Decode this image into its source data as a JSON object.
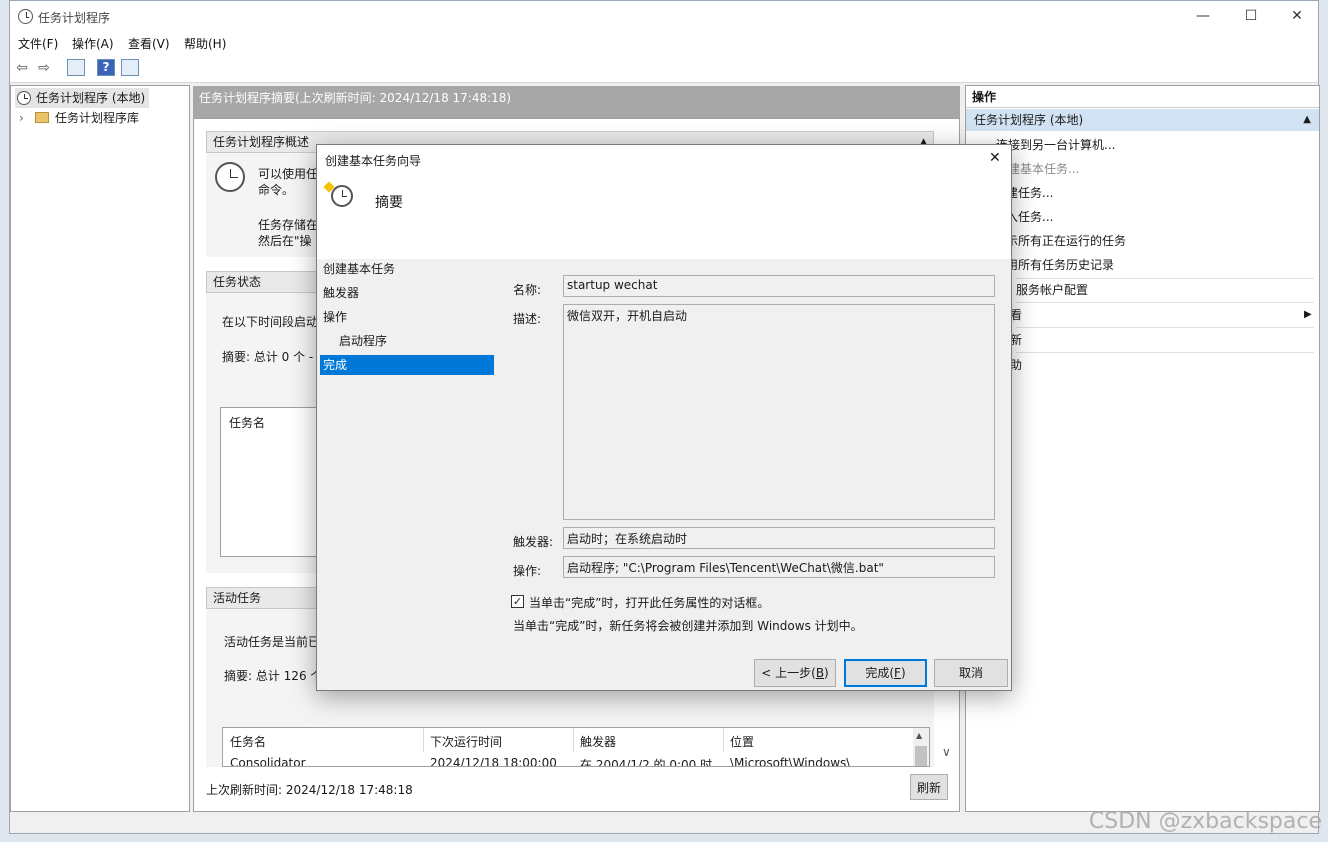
{
  "window": {
    "title": "任务计划程序",
    "minimize": "—",
    "maximize": "☐",
    "close": "✕"
  },
  "menu": [
    "文件(F)",
    "操作(A)",
    "查看(V)",
    "帮助(H)"
  ],
  "toolbar": {
    "back": "⇦",
    "forward": "⇨",
    "help": "?"
  },
  "tree": {
    "root": "任务计划程序 (本地)",
    "library": "任务计划程序库",
    "expander": "›"
  },
  "middle": {
    "header": "任务计划程序摘要(上次刷新时间: 2024/12/18 17:48:18)",
    "overview": {
      "title": "任务计划程序概述",
      "line1": "可以使用任",
      "line2": "命令。",
      "line3": "任务存储在",
      "line4": "然后在\"操"
    },
    "status": {
      "title": "任务状态",
      "line1": "在以下时间段启动",
      "summary": "摘要: 总计 0 个 -",
      "col_task": "任务名"
    },
    "active": {
      "title": "活动任务",
      "line1": "活动任务是当前已",
      "summary": "摘要: 总计 126 个",
      "columns": [
        "任务名",
        "下次运行时间",
        "触发器",
        "位置"
      ],
      "row": [
        "Consolidator",
        "2024/12/18 18:00:00",
        "在 2004/1/2 的 0:00 时",
        "\\Microsoft\\Windows\\"
      ]
    },
    "footer": "上次刷新时间: 2024/12/18 17:48:18",
    "refresh": "刷新",
    "scroll_up": "▲",
    "scroll_down": "∨"
  },
  "actions": {
    "title": "操作",
    "subtitle": "任务计划程序 (本地)",
    "collapse": "▲",
    "submenu_arrow": "▶",
    "items": [
      "连接到另一台计算机...",
      "创建基本任务...",
      "建任务...",
      "入任务...",
      "示所有正在运行的任务",
      "用所有任务历史记录",
      "服务帐户配置",
      "看",
      "新",
      "助"
    ]
  },
  "dialog": {
    "title": "创建基本任务向导",
    "close": "✕",
    "heading": "摘要",
    "steps": [
      "创建基本任务",
      "触发器",
      "操作",
      "启动程序",
      "完成"
    ],
    "labels": {
      "name": "名称:",
      "desc": "描述:",
      "trigger": "触发器:",
      "action": "操作:"
    },
    "values": {
      "name": "startup wechat",
      "desc": "微信双开，开机自启动",
      "trigger": "启动时；在系统启动时",
      "action": "启动程序; \"C:\\Program Files\\Tencent\\WeChat\\微信.bat\""
    },
    "checkbox_label": "当单击“完成”时，打开此任务属性的对话框。",
    "checkbox_mark": "✓",
    "info": "当单击“完成”时，新任务将会被创建并添加到 Windows 计划中。",
    "buttons": {
      "back_prefix": "< 上一步(",
      "back_key": "B",
      "finish_prefix": "完成(",
      "finish_key": "F",
      "suffix": ")",
      "cancel": "取消"
    }
  },
  "watermark": "CSDN @zxbackspace"
}
